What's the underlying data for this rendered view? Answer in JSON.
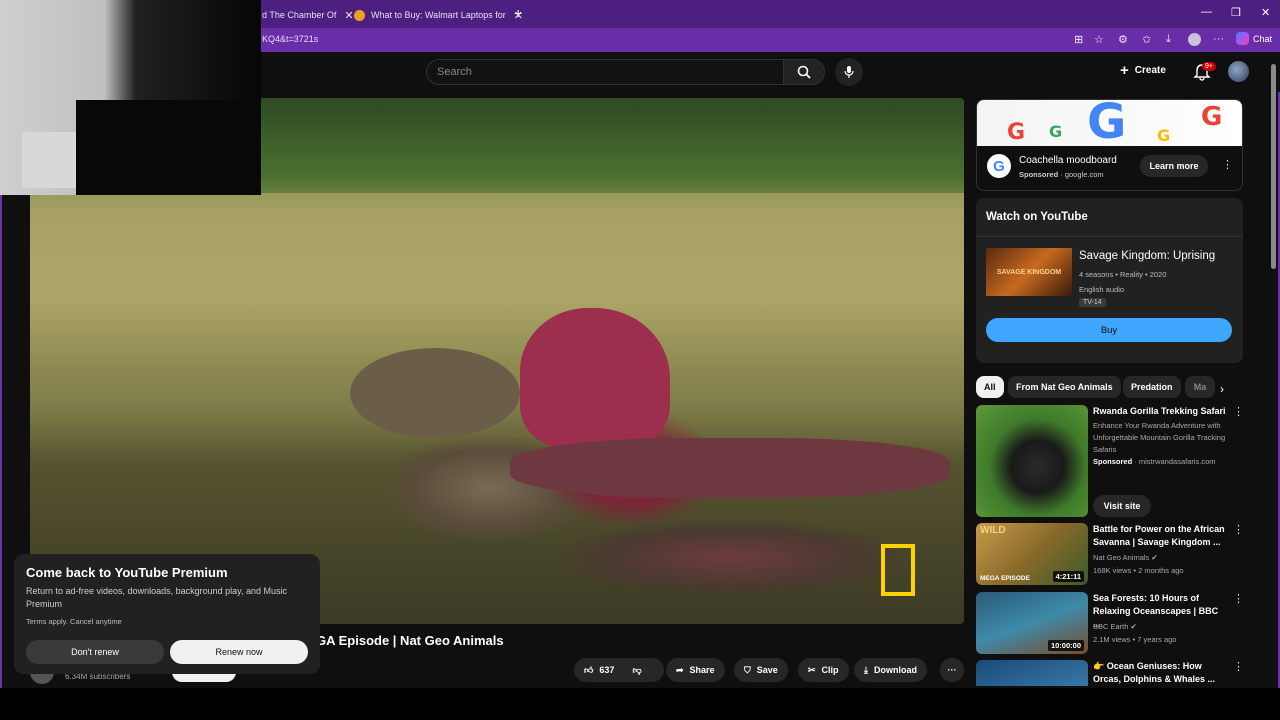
{
  "browser": {
    "tabs": [
      {
        "label": "d The Chamber Of"
      },
      {
        "label": "What to Buy: Walmart Laptops for"
      }
    ],
    "url": "KQ4&t=3721s",
    "chat_label": "Chat"
  },
  "youtube": {
    "search_placeholder": "Search",
    "create_label": "Create",
    "notification_badge": "9+"
  },
  "premium_popup": {
    "title": "Come back to YouTube Premium",
    "body": "Return to ad-free videos, downloads, background play, and Music Premium",
    "terms": "Terms apply. Cancel anytime",
    "dont_renew": "Don't renew",
    "renew_now": "Renew now"
  },
  "video": {
    "title_visible": "GA Episode | Nat Geo Animals",
    "subscribers": "6.34M subscribers",
    "likes": "637",
    "share": "Share",
    "save": "Save",
    "clip": "Clip",
    "download": "Download"
  },
  "ad": {
    "title": "Coachella moodboard",
    "sponsored": "Sponsored",
    "domain": "google.com",
    "learn_more": "Learn more"
  },
  "watch_card": {
    "heading": "Watch on YouTube",
    "show_title": "Savage Kingdom: Uprising",
    "meta1": "4 seasons • Reality • 2020",
    "meta2": "English audio",
    "rating": "TV-14",
    "buy": "Buy",
    "poster_text": "SAVAGE KINGDOM"
  },
  "chips": [
    {
      "label": "All"
    },
    {
      "label": "From Nat Geo Animals"
    },
    {
      "label": "Predation"
    },
    {
      "label": "Ma"
    }
  ],
  "recommendations": [
    {
      "title": "Rwanda Gorilla Trekking Safari",
      "desc": "Enhance Your Rwanda Adventure with Unforgettable Mountain Gorilla Tracking Safaris",
      "sponsored": "Sponsored",
      "domain": "mistrwandasafaris.com",
      "cta": "Visit site"
    },
    {
      "title": "Battle for Power on the African Savanna | Savage Kingdom ...",
      "channel": "Nat Geo Animals",
      "stats": "168K views • 2 months ago",
      "duration": "4:21:11",
      "badge_top": "WILD",
      "badge_bottom": "MEGA EPISODE"
    },
    {
      "title": "Sea Forests: 10 Hours of Relaxing Oceanscapes | BBC ...",
      "channel": "BBC Earth",
      "stats": "2.1M views • 7 years ago",
      "duration": "10:00:00"
    },
    {
      "title": "👉 Ocean Geniuses: How Orcas, Dolphins & Whales ..."
    }
  ],
  "colors": {
    "tab_bar": "#4d1f80",
    "address_bar": "#6a2da8",
    "buy_button": "#3ea6ff",
    "annotation_box": "#ffd200"
  }
}
